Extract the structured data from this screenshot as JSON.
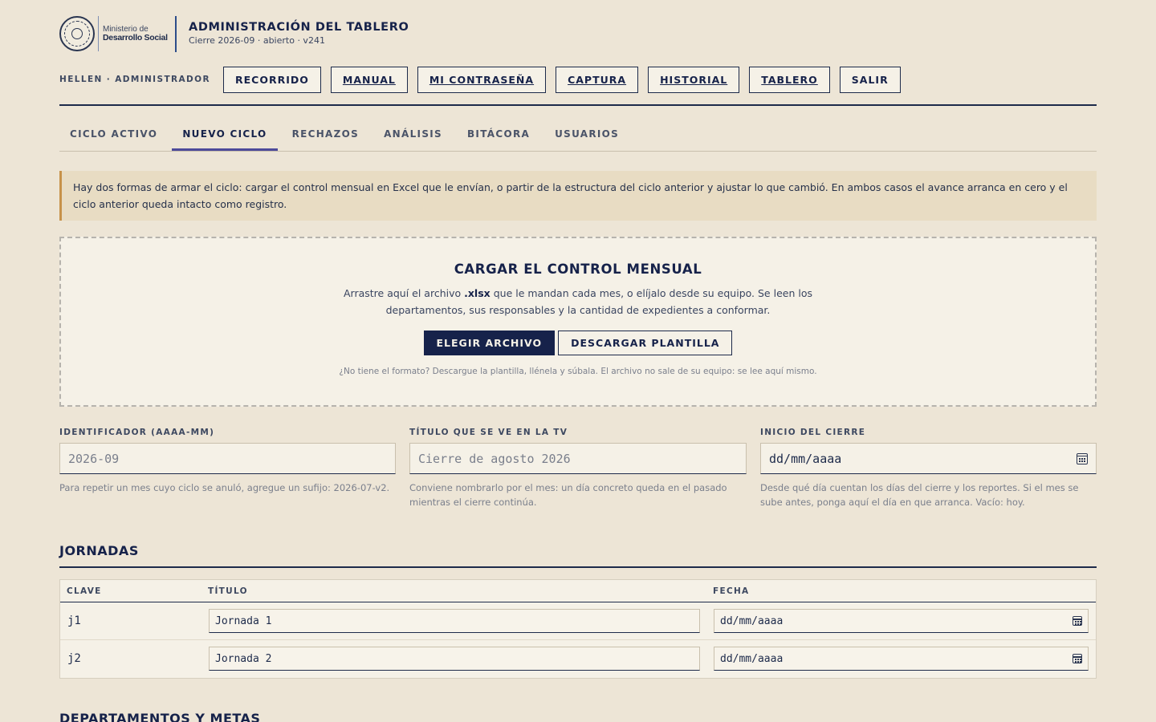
{
  "header": {
    "logo": {
      "line1": "Ministerio de",
      "line2": "Desarrollo Social",
      "seal_text_top": "GOBIERNO DE LA REPÚBLICA",
      "seal_text_bottom": "GUATEMALA"
    },
    "title": "ADMINISTRACIÓN DEL TABLERO",
    "subtitle": "Cierre 2026-09 · abierto · v241",
    "user_line": "HELLEN · ADMINISTRADOR",
    "nav_buttons": [
      {
        "label": "RECORRIDO"
      },
      {
        "label": "MANUAL"
      },
      {
        "label": "MI CONTRASEÑA"
      },
      {
        "label": "CAPTURA"
      },
      {
        "label": "HISTORIAL"
      },
      {
        "label": "TABLERO"
      },
      {
        "label": "SALIR"
      }
    ]
  },
  "tabs": [
    {
      "label": "CICLO ACTIVO",
      "active": false
    },
    {
      "label": "NUEVO CICLO",
      "active": true
    },
    {
      "label": "RECHAZOS",
      "active": false
    },
    {
      "label": "ANÁLISIS",
      "active": false
    },
    {
      "label": "BITÁCORA",
      "active": false
    },
    {
      "label": "USUARIOS",
      "active": false
    }
  ],
  "notice": "Hay dos formas de armar el ciclo: cargar el control mensual en Excel que le envían, o partir de la estructura del ciclo anterior y ajustar lo que cambió. En ambos casos el avance arranca en cero y el ciclo anterior queda intacto como registro.",
  "upload": {
    "title": "CARGAR EL CONTROL MENSUAL",
    "desc_before": "Arrastre aquí el archivo ",
    "desc_ext": ".xlsx",
    "desc_after": " que le mandan cada mes, o elíjalo desde su equipo. Se leen los departamentos, sus responsables y la cantidad de expedientes a conformar.",
    "choose_label": "ELEGIR ARCHIVO",
    "template_label": "DESCARGAR PLANTILLA",
    "note": "¿No tiene el formato? Descargue la plantilla, llénela y súbala. El archivo no sale de su equipo: se lee aquí mismo."
  },
  "form": {
    "id": {
      "label": "IDENTIFICADOR (AAAA-MM)",
      "placeholder": "2026-09",
      "help": "Para repetir un mes cuyo ciclo se anuló, agregue un sufijo: 2026-07-v2."
    },
    "tv_title": {
      "label": "TÍTULO QUE SE VE EN LA TV",
      "placeholder": "Cierre de agosto 2026",
      "help": "Conviene nombrarlo por el mes: un día concreto queda en el pasado mientras el cierre continúa."
    },
    "start": {
      "label": "INICIO DEL CIERRE",
      "value": "dd/mm/aaaa",
      "help": "Desde qué día cuentan los días del cierre y los reportes. Si el mes se sube antes, ponga aquí el día en que arranca. Vacío: hoy."
    }
  },
  "jornadas": {
    "title": "JORNADAS",
    "columns": [
      "CLAVE",
      "TÍTULO",
      "FECHA"
    ],
    "rows": [
      {
        "key": "j1",
        "title": "Jornada 1",
        "date": "dd/mm/aaaa"
      },
      {
        "key": "j2",
        "title": "Jornada 2",
        "date": "dd/mm/aaaa"
      }
    ]
  },
  "departments": {
    "title": "DEPARTAMENTOS Y METAS"
  },
  "colors": {
    "background": "#ede5d6",
    "navy": "#16224a",
    "notice_bg": "#e8dcc3",
    "notice_accent": "#c7924a",
    "tab_indicator": "#4d4a9a"
  },
  "icons": [
    "seal-logo",
    "calendar-icon"
  ]
}
